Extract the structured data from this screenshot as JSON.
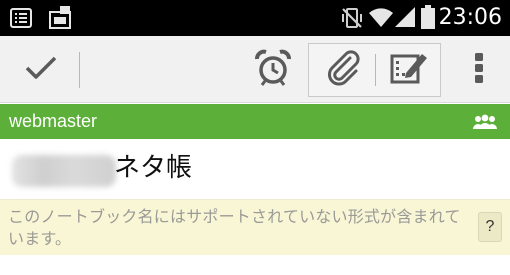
{
  "status_bar": {
    "time": "23:06",
    "icons": [
      "notification-list-icon",
      "sim-card-icon",
      "vibrate-off-icon",
      "wifi-icon",
      "signal-icon",
      "battery-icon"
    ]
  },
  "action_bar": {
    "buttons": [
      "checkmark-icon",
      "alarm-clock-icon",
      "paperclip-icon",
      "edit-note-icon",
      "overflow-menu-icon"
    ]
  },
  "notebook": {
    "name": "webmaster",
    "shared_icon": "shared-people-icon"
  },
  "note": {
    "title": "ネタ帳"
  },
  "warning": {
    "message": "このノートブック名にはサポートされていない形式が含まれています。",
    "help_label": "?"
  },
  "colors": {
    "status_bar": "#000000",
    "action_bar": "#f1f1f1",
    "notebook_bar": "#5cb039",
    "warning_bg": "#f9f6d6",
    "warning_text": "#9a9a96",
    "icon_gray": "#5a5a5a"
  }
}
